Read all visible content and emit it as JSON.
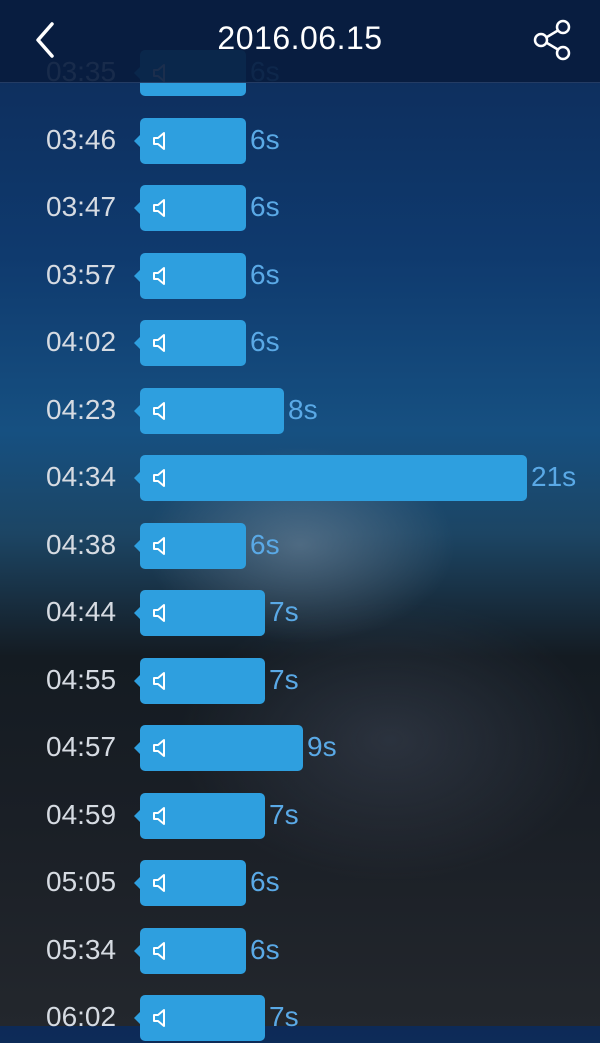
{
  "header": {
    "title": "2016.06.15",
    "back_icon": "chevron-left-icon",
    "share_icon": "share-icon"
  },
  "recordings": [
    {
      "time": "03:35",
      "duration": "6s",
      "seconds": 6
    },
    {
      "time": "03:46",
      "duration": "6s",
      "seconds": 6
    },
    {
      "time": "03:47",
      "duration": "6s",
      "seconds": 6
    },
    {
      "time": "03:57",
      "duration": "6s",
      "seconds": 6
    },
    {
      "time": "04:02",
      "duration": "6s",
      "seconds": 6
    },
    {
      "time": "04:23",
      "duration": "8s",
      "seconds": 8
    },
    {
      "time": "04:34",
      "duration": "21s",
      "seconds": 21
    },
    {
      "time": "04:38",
      "duration": "6s",
      "seconds": 6
    },
    {
      "time": "04:44",
      "duration": "7s",
      "seconds": 7
    },
    {
      "time": "04:55",
      "duration": "7s",
      "seconds": 7
    },
    {
      "time": "04:57",
      "duration": "9s",
      "seconds": 9
    },
    {
      "time": "04:59",
      "duration": "7s",
      "seconds": 7
    },
    {
      "time": "05:05",
      "duration": "6s",
      "seconds": 6
    },
    {
      "time": "05:34",
      "duration": "6s",
      "seconds": 6
    },
    {
      "time": "06:02",
      "duration": "7s",
      "seconds": 7
    }
  ],
  "colors": {
    "bubble": "#2e9fdf",
    "duration_text": "#5aa9e6",
    "time_text": "#d6dbe2"
  },
  "speaker_icon": "speaker-icon"
}
